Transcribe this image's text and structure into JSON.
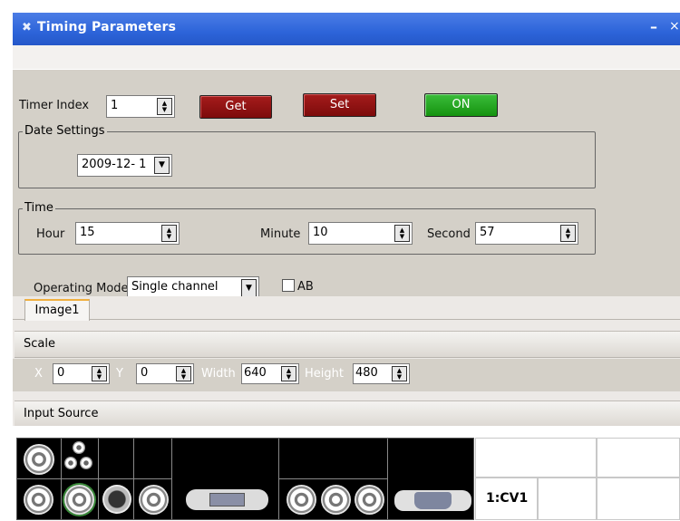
{
  "window": {
    "title": "Timing Parameters",
    "icon": "app-icon",
    "minimize": "–",
    "close": "×"
  },
  "timer": {
    "label": "Timer Index",
    "value": "1",
    "get": "Get",
    "set": "Set",
    "on": "ON"
  },
  "date": {
    "legend": "Date Settings",
    "value": "2009-12- 1"
  },
  "time": {
    "legend": "Time",
    "hour_label": "Hour",
    "hour": "15",
    "minute_label": "Minute",
    "minute": "10",
    "second_label": "Second",
    "second": "57"
  },
  "mode": {
    "label": "Operating Mode",
    "value": "Single channel",
    "ab_label": "AB",
    "ab_checked": false
  },
  "tabs": [
    {
      "label": "Image1",
      "active": true
    }
  ],
  "scale": {
    "title": "Scale",
    "x_label": "X",
    "x": "0",
    "y_label": "Y",
    "y": "0",
    "width_label": "Width",
    "width": "640",
    "height_label": "Height",
    "height": "480"
  },
  "input": {
    "title": "Input Source",
    "selected_source": "1:CV1"
  },
  "colors": {
    "titlebar": "#2d64d9",
    "get_set": "#8b1111",
    "on": "#1fa51a"
  }
}
